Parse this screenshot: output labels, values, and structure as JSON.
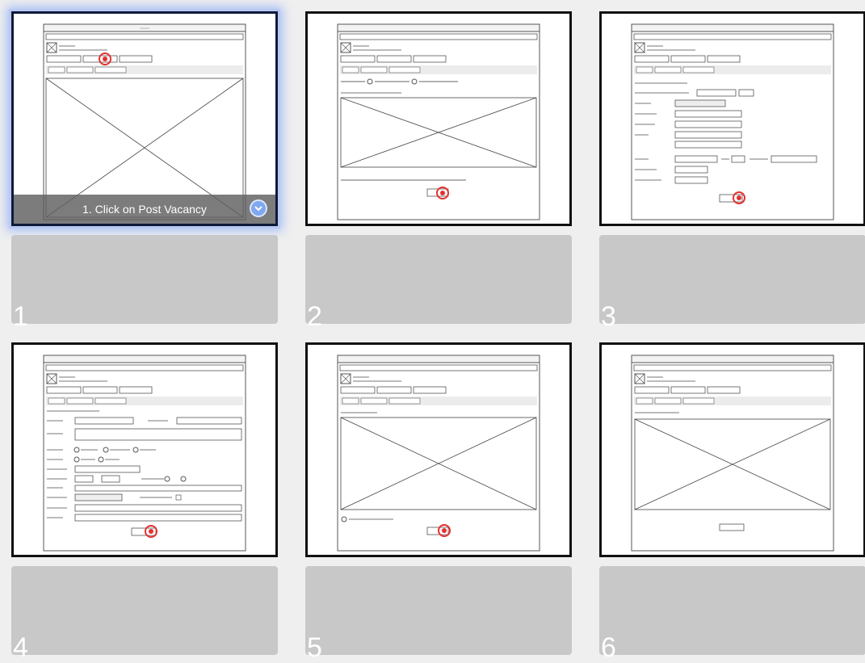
{
  "steps": [
    {
      "number": "1",
      "caption": "1. Click on Post Vacancy",
      "selected": true,
      "screen": "home"
    },
    {
      "number": "2",
      "caption": "",
      "selected": false,
      "screen": "type-choice"
    },
    {
      "number": "3",
      "caption": "",
      "selected": false,
      "screen": "employer-form"
    },
    {
      "number": "4",
      "caption": "",
      "selected": false,
      "screen": "vacancy-form"
    },
    {
      "number": "5",
      "caption": "",
      "selected": false,
      "screen": "review"
    },
    {
      "number": "6",
      "caption": "",
      "selected": false,
      "screen": "done"
    }
  ],
  "colors": {
    "selection_glow": "#a8bff5",
    "click_marker": "#e53030",
    "caption_bar": "#5f5f5f",
    "slot": "#c8c8c8"
  },
  "icons": {
    "caption_action": "chevron-down-icon"
  }
}
